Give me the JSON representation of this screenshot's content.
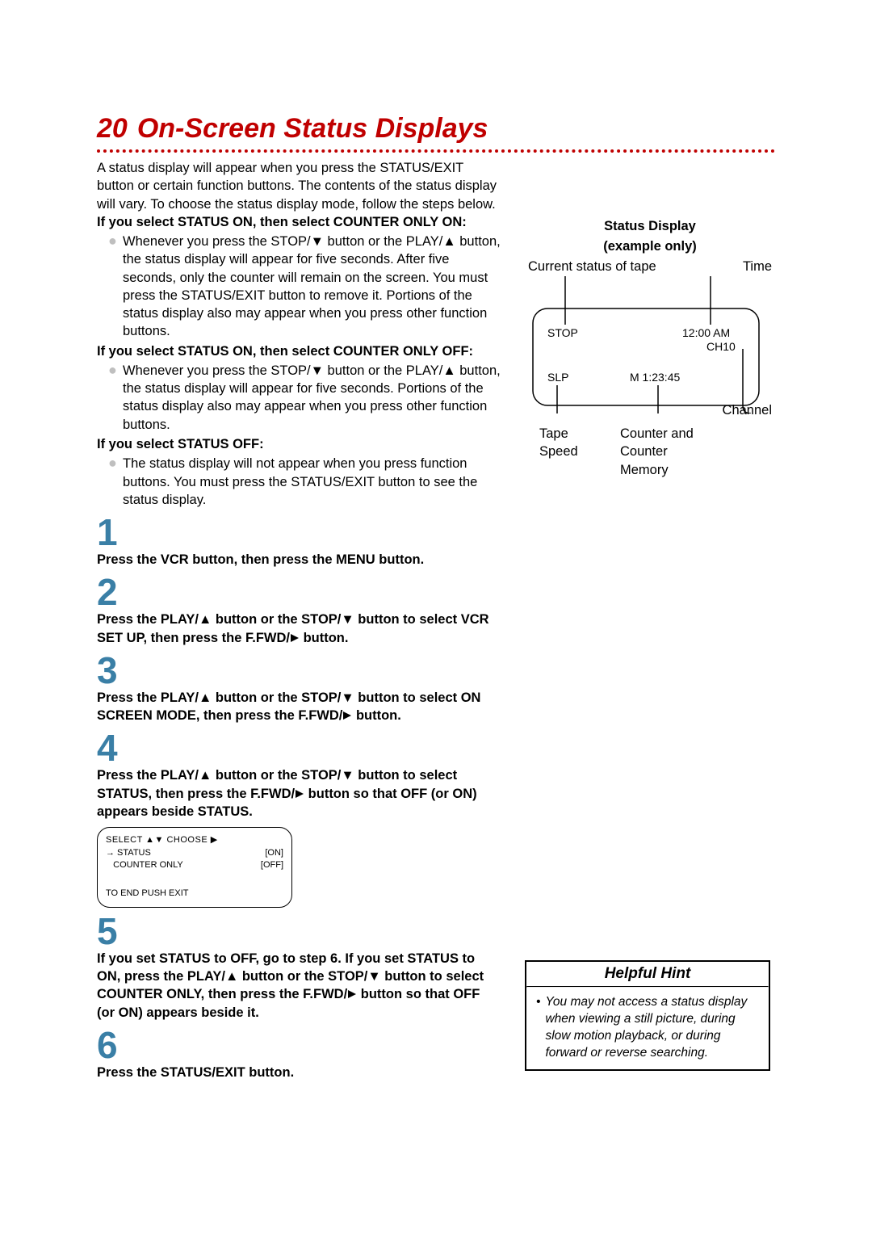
{
  "title": {
    "number": "20",
    "text": "On-Screen Status Displays"
  },
  "intro": "A status display will appear when you press the STATUS/EXIT button or certain function buttons. The contents of the status display will vary. To choose the status display mode, follow the steps below.",
  "sections": [
    {
      "heading": "If you select STATUS ON, then select COUNTER ONLY ON:",
      "bullet": "Whenever you press the STOP/▼ button or the PLAY/▲ button, the status display will appear for five seconds. After five seconds, only the counter will remain on the screen. You must press the STATUS/EXIT button to remove it. Portions of the status display also may appear when you press other function buttons."
    },
    {
      "heading": "If you select STATUS ON, then select COUNTER ONLY OFF:",
      "bullet": "Whenever you press the STOP/▼ button or the PLAY/▲ button, the status display will appear for five seconds. Portions of the status display also may appear when you press other function buttons."
    },
    {
      "heading": "If you select STATUS OFF:",
      "bullet": "The status display will not appear when you press function buttons. You must press the STATUS/EXIT button to see the status display."
    }
  ],
  "steps": [
    {
      "n": "1",
      "body_pre": "Press the VCR button, then press the MENU button.",
      "body_post": ""
    },
    {
      "n": "2",
      "body_pre": "Press the PLAY/▲ button or the STOP/▼ button to select VCR SET UP, then press the F.FWD/",
      "body_post": " button."
    },
    {
      "n": "3",
      "body_pre": "Press the PLAY/▲ button or the STOP/▼ button to select ON SCREEN MODE, then press the F.FWD/",
      "body_post": " button."
    },
    {
      "n": "4",
      "body_pre": "Press the PLAY/▲ button or the STOP/▼ button to select STATUS, then press the F.FWD/",
      "body_post": " button so that OFF (or ON) appears beside STATUS."
    },
    {
      "n": "5",
      "body_pre": "If you set STATUS to OFF, go to step 6. If you set STATUS to ON, press the PLAY/▲ button or the STOP/▼ button to select COUNTER ONLY, then press the F.FWD/",
      "body_post": " button so that OFF (or ON) appears beside it."
    },
    {
      "n": "6",
      "body_pre": "Press the STATUS/EXIT button",
      "body_post": "."
    }
  ],
  "osd": {
    "header": "SELECT ▲▼ CHOOSE ▶",
    "rows": [
      {
        "left": "→ STATUS",
        "right": "[ON]"
      },
      {
        "left": "   COUNTER ONLY",
        "right": "[OFF]"
      }
    ],
    "footer": "TO END PUSH EXIT"
  },
  "status_display": {
    "title1": "Status Display",
    "title2": "(example only)",
    "top_left": "Current status of tape",
    "top_right": "Time",
    "values": {
      "stop": "STOP",
      "time": "12:00 AM",
      "ch": "CH10",
      "speed": "SLP",
      "counter": "M  1:23:45"
    },
    "label_channel": "Channel",
    "label_tape_speed": "Tape Speed",
    "label_counter": "Counter and Counter Memory"
  },
  "hint": {
    "title": "Helpful Hint",
    "body": "You may not access a status display when viewing a still picture, during slow motion playback, or during forward or reverse searching."
  }
}
